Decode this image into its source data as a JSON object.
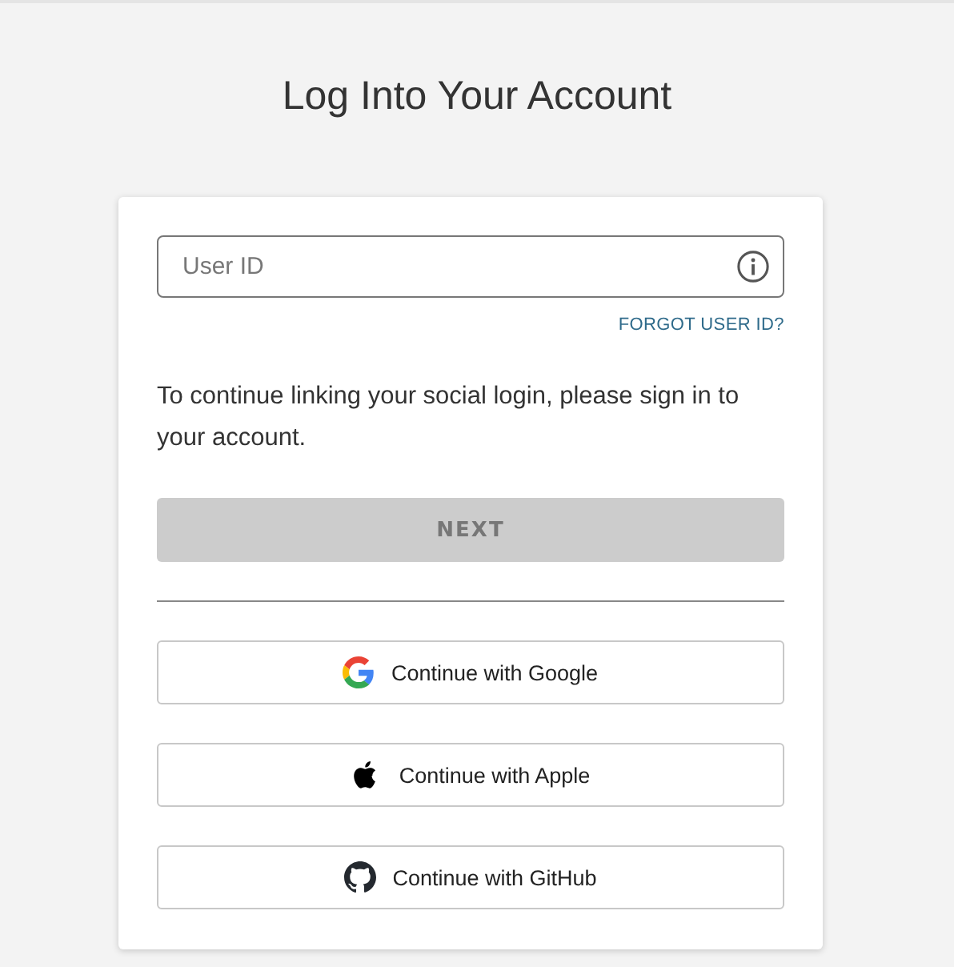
{
  "title": "Log Into Your Account",
  "user_id_field": {
    "placeholder": "User ID"
  },
  "forgot_link": "FORGOT USER ID?",
  "message": "To continue linking your social login, please sign in to your account.",
  "next_button": {
    "label": "NEXT",
    "disabled": true
  },
  "social_buttons": [
    {
      "kind": "google",
      "label": "Continue with Google"
    },
    {
      "kind": "apple",
      "label": "Continue with Apple"
    },
    {
      "kind": "github",
      "label": "Continue with GitHub"
    }
  ]
}
